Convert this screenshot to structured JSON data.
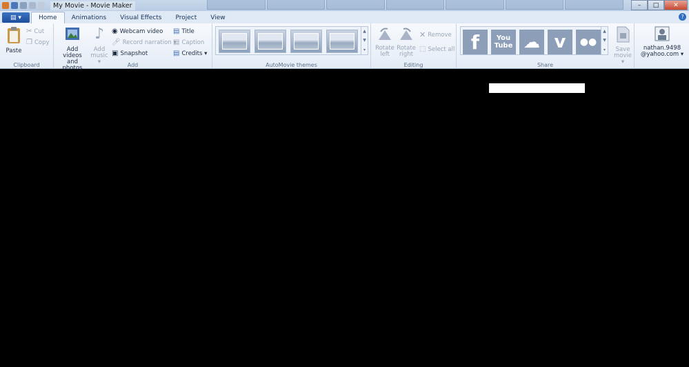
{
  "window": {
    "title": "My Movie - Movie Maker",
    "controls": {
      "minimize": "–",
      "maximize": "□",
      "close": "✕"
    }
  },
  "file_menu": {
    "label": "▤ ▾"
  },
  "tabs": [
    {
      "label": "Home"
    },
    {
      "label": "Animations"
    },
    {
      "label": "Visual Effects"
    },
    {
      "label": "Project"
    },
    {
      "label": "View"
    }
  ],
  "help": {
    "label": "?"
  },
  "ribbon": {
    "clipboard": {
      "group_label": "Clipboard",
      "paste": "Paste",
      "cut": "Cut",
      "copy": "Copy"
    },
    "add": {
      "group_label": "Add",
      "add_videos_line1": "Add videos",
      "add_videos_line2": "and photos",
      "add_music_line1": "Add",
      "add_music_line2": "music ▾",
      "webcam": "Webcam video",
      "record_narration": "Record narration ▾",
      "snapshot": "Snapshot",
      "title": "Title",
      "caption": "Caption",
      "credits": "Credits ▾"
    },
    "themes": {
      "group_label": "AutoMovie themes"
    },
    "editing": {
      "group_label": "Editing",
      "rotate_left_line1": "Rotate",
      "rotate_left_line2": "left",
      "rotate_right_line1": "Rotate",
      "rotate_right_line2": "right",
      "remove": "Remove",
      "select_all": "Select all"
    },
    "share": {
      "group_label": "Share",
      "icons": [
        {
          "name": "facebook-icon",
          "glyph": "f"
        },
        {
          "name": "youtube-icon",
          "glyph": "You Tube"
        },
        {
          "name": "onedrive-icon",
          "glyph": "☁"
        },
        {
          "name": "vimeo-icon",
          "glyph": "v"
        },
        {
          "name": "flickr-icon",
          "glyph": "●●"
        }
      ],
      "save_movie_line1": "Save",
      "save_movie_line2": "movie ▾"
    },
    "account": {
      "user_line1": "nathan.9498",
      "user_line2": "@yahoo.com ▾"
    }
  },
  "colors": {
    "ribbon_bg": "#eef3f9",
    "accent": "#2f6ec0",
    "canvas": "#000000"
  }
}
